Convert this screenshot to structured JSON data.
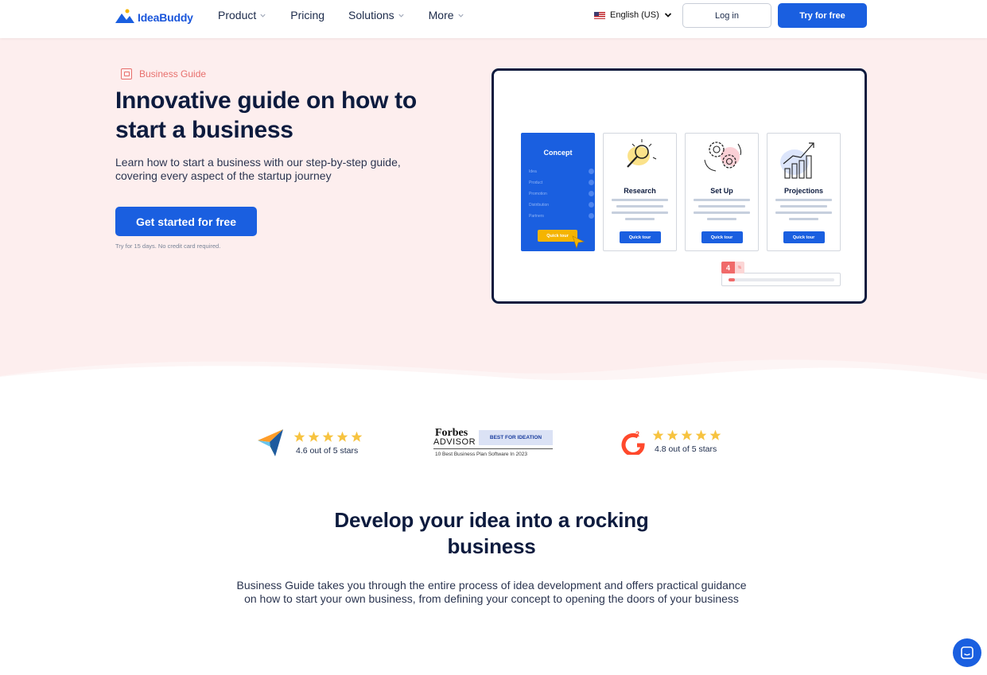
{
  "nav": {
    "logo_text": "IdeaBuddy",
    "menu": [
      {
        "label": "Product",
        "has_dropdown": true
      },
      {
        "label": "Pricing",
        "has_dropdown": false
      },
      {
        "label": "Solutions",
        "has_dropdown": true
      },
      {
        "label": "More",
        "has_dropdown": true
      }
    ],
    "language": "English (US)",
    "login_label": "Log in",
    "try_label": "Try for free"
  },
  "hero": {
    "tag": "Business Guide",
    "title": "Innovative guide on how to start a business",
    "subtitle": "Learn how to start a business with our step-by-step guide, covering every aspect of the startup journey",
    "cta_label": "Get started for free",
    "trial_note": "Try for 15 days. No credit card required."
  },
  "preview": {
    "concept": {
      "title": "Concept",
      "items": [
        "Idea",
        "Product",
        "Promotion",
        "Distribution",
        "Partners"
      ],
      "button": "Quick tour"
    },
    "cards": [
      {
        "title": "Research",
        "button": "Quick tour",
        "icon": "magnifier-icon"
      },
      {
        "title": "Set Up",
        "button": "Quick tour",
        "icon": "gears-icon"
      },
      {
        "title": "Projections",
        "button": "Quick tour",
        "icon": "growth-chart-icon"
      }
    ],
    "progress": {
      "value": "4",
      "unit": "%",
      "fraction": 0.04
    }
  },
  "ratings": {
    "capterra": {
      "text": "4.6 out of 5 stars",
      "stars": 5
    },
    "forbes": {
      "word": "Forbes",
      "advisor": "ADVISOR",
      "badge": "BEST FOR IDEATION",
      "sub": "10 Best Business Plan Software In 2023"
    },
    "g2": {
      "text": "4.8 out of 5 stars",
      "stars": 5
    }
  },
  "section": {
    "title": "Develop your idea into a rocking business",
    "body": "Business Guide takes you through the entire process of idea development and offers practical guidance on how to start your own business, from defining your concept to opening the doors of your business"
  },
  "colors": {
    "brand": "#1a5fe0",
    "hero_bg": "#fdeeee",
    "accent_red": "#f06a6a",
    "star": "#f7c340"
  }
}
